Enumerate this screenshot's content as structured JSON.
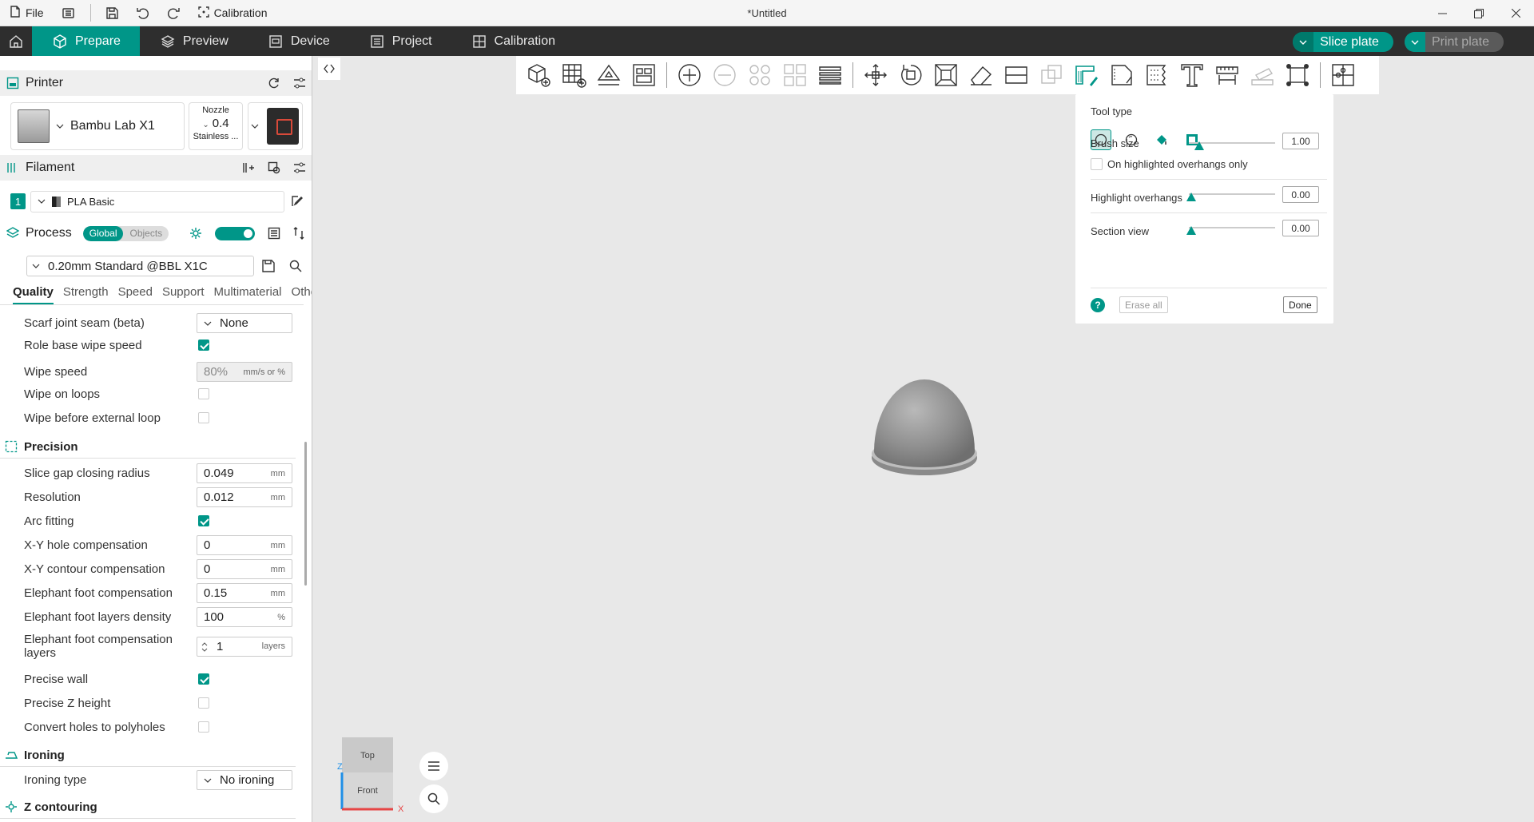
{
  "window": {
    "title": "*Untitled",
    "file_label": "File",
    "calibration_label": "Calibration"
  },
  "tabs": {
    "prepare": "Prepare",
    "preview": "Preview",
    "device": "Device",
    "project": "Project",
    "calibration": "Calibration"
  },
  "actions": {
    "slice": "Slice plate",
    "print": "Print plate"
  },
  "printer": {
    "header": "Printer",
    "name": "Bambu Lab X1",
    "nozzle_label": "Nozzle",
    "nozzle_value": "0.4",
    "nozzle_material": "Stainless ..."
  },
  "filament": {
    "header": "Filament",
    "index": "1",
    "name": "PLA Basic"
  },
  "process": {
    "header": "Process",
    "seg_global": "Global",
    "seg_objects": "Objects",
    "preset": "0.20mm Standard @BBL X1C",
    "tabs": [
      "Quality",
      "Strength",
      "Speed",
      "Support",
      "Multimaterial",
      "Others"
    ]
  },
  "settings": {
    "scarf": {
      "label": "Scarf joint seam (beta)",
      "value": "None"
    },
    "role_wipe": {
      "label": "Role base wipe speed",
      "checked": true
    },
    "wipe_speed": {
      "label": "Wipe speed",
      "value": "80%",
      "unit": "mm/s or %"
    },
    "wipe_loops": {
      "label": "Wipe on loops",
      "checked": false
    },
    "wipe_ext": {
      "label": "Wipe before external loop",
      "checked": false
    },
    "precision_header": "Precision",
    "slice_gap": {
      "label": "Slice gap closing radius",
      "value": "0.049",
      "unit": "mm"
    },
    "resolution": {
      "label": "Resolution",
      "value": "0.012",
      "unit": "mm"
    },
    "arc": {
      "label": "Arc fitting",
      "checked": true
    },
    "xy_hole": {
      "label": "X-Y hole compensation",
      "value": "0",
      "unit": "mm"
    },
    "xy_contour": {
      "label": "X-Y contour compensation",
      "value": "0",
      "unit": "mm"
    },
    "ef_comp": {
      "label": "Elephant foot compensation",
      "value": "0.15",
      "unit": "mm"
    },
    "ef_density": {
      "label": "Elephant foot layers density",
      "value": "100",
      "unit": "%"
    },
    "ef_layers": {
      "label": "Elephant foot compensation layers",
      "value": "1",
      "unit": "layers"
    },
    "precise_wall": {
      "label": "Precise wall",
      "checked": true
    },
    "precise_z": {
      "label": "Precise Z height",
      "checked": false
    },
    "holes_poly": {
      "label": "Convert holes to polyholes",
      "checked": false
    },
    "ironing_header": "Ironing",
    "ironing_type": {
      "label": "Ironing type",
      "value": "No ironing"
    },
    "z_header": "Z contouring"
  },
  "paint": {
    "tool_type": "Tool type",
    "brush_size_label": "Brush size",
    "brush_size_value": "1.00",
    "overhang_only": "On highlighted overhangs only",
    "highlight_label": "Highlight overhangs",
    "highlight_value": "0.00",
    "section_label": "Section view",
    "section_value": "0.00",
    "help": "?",
    "erase_all": "Erase all",
    "done": "Done"
  },
  "viewcube": {
    "top": "Top",
    "front": "Front",
    "axis_x": "X",
    "axis_z": "Z"
  },
  "colors": {
    "accent": "#009688",
    "tabbar": "#2e2e2e",
    "canvas": "#e8e8e8"
  }
}
